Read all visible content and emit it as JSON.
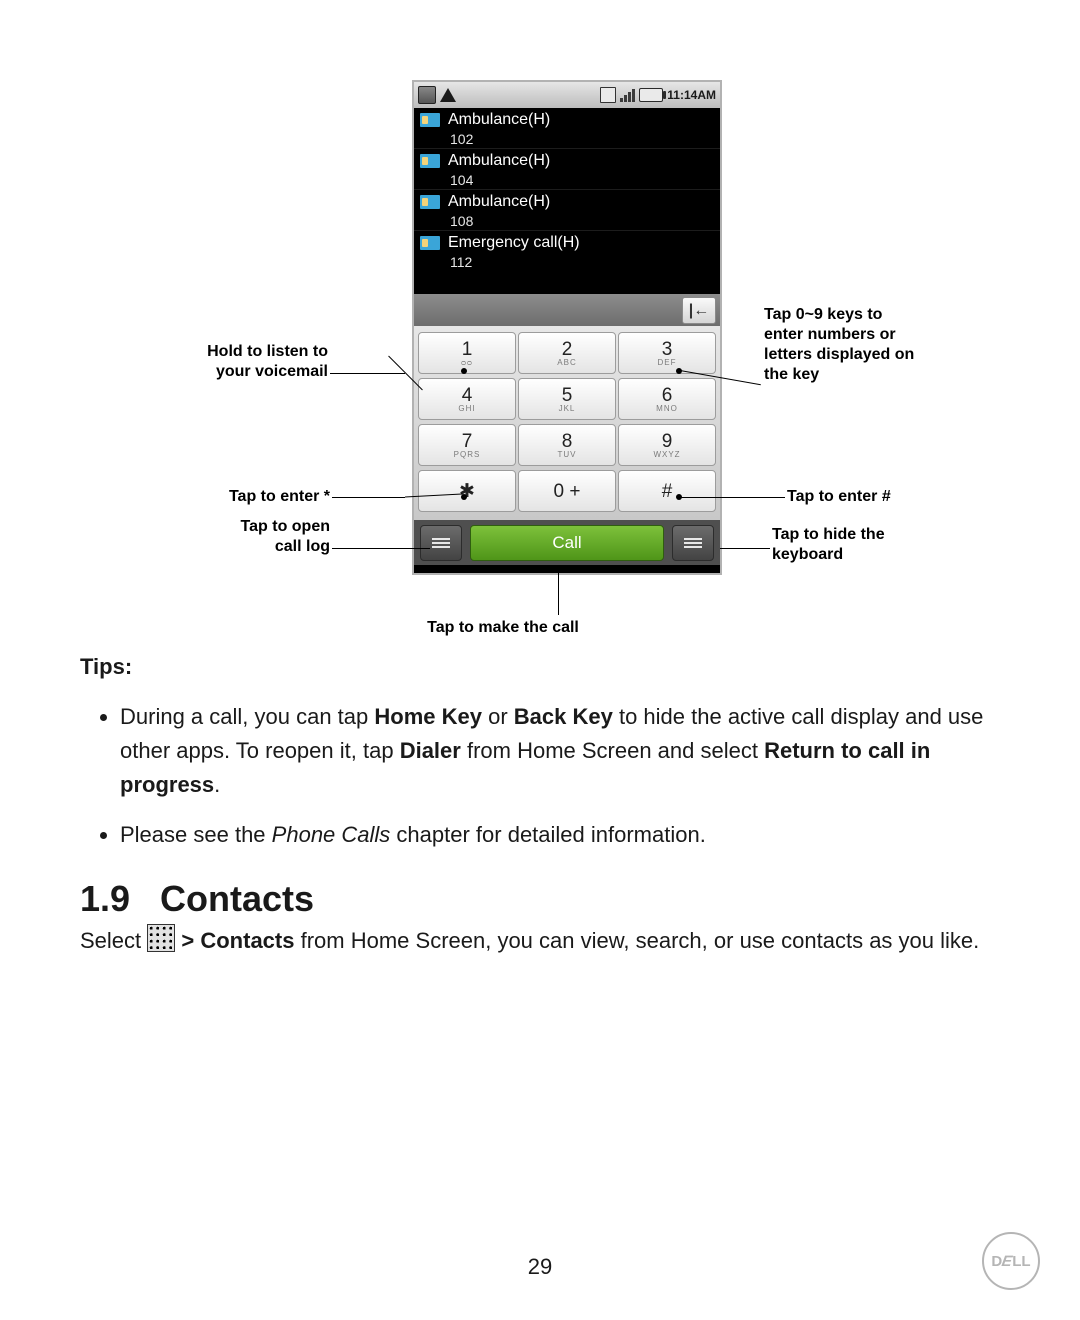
{
  "statusbar": {
    "time": "11:14AM"
  },
  "contacts": [
    {
      "name": "Ambulance(H)",
      "number": "102"
    },
    {
      "name": "Ambulance(H)",
      "number": "104"
    },
    {
      "name": "Ambulance(H)",
      "number": "108"
    },
    {
      "name": "Emergency call(H)",
      "number": "112"
    }
  ],
  "backspace_glyph": "|←",
  "keys": [
    [
      {
        "d": "1",
        "s": "ᴑᴑ"
      },
      {
        "d": "2",
        "s": "ABC"
      },
      {
        "d": "3",
        "s": "DEF"
      }
    ],
    [
      {
        "d": "4",
        "s": "GHI"
      },
      {
        "d": "5",
        "s": "JKL"
      },
      {
        "d": "6",
        "s": "MNO"
      }
    ],
    [
      {
        "d": "7",
        "s": "PQRS"
      },
      {
        "d": "8",
        "s": "TUV"
      },
      {
        "d": "9",
        "s": "WXYZ"
      }
    ],
    [
      {
        "d": "✱",
        "s": ""
      },
      {
        "d": "0 +",
        "s": ""
      },
      {
        "d": "#",
        "s": ""
      }
    ]
  ],
  "call_label": "Call",
  "callouts": {
    "voicemail": "Hold to listen to\nyour voicemail",
    "enterstar": "Tap to enter *",
    "calllog": "Tap to open\ncall log",
    "makecall": "Tap to make the call",
    "numkeys": "Tap 0~9 keys to\nenter numbers or\nletters displayed on\nthe key",
    "enterhash": "Tap to enter #",
    "hidekbd": "Tap to hide the\nkeyboard"
  },
  "tips_heading": "Tips:",
  "tips": {
    "t1a": "During a call, you can tap ",
    "t1b": "Home Key",
    "t1c": " or ",
    "t1d": "Back Key",
    "t1e": " to hide the active call display and use other apps. To reopen it, tap ",
    "t1f": "Dialer",
    "t1g": " from Home Screen and select ",
    "t1h": "Return to call in progress",
    "t1i": ".",
    "t2a": "Please see the ",
    "t2b": "Phone Calls",
    "t2c": " chapter for detailed information."
  },
  "section": {
    "num": "1.9",
    "title": "Contacts"
  },
  "section_body": {
    "a": "Select  ",
    "b": " > Contacts",
    "c": " from Home Screen, you can view, search, or use contacts as you like."
  },
  "page_number": "29",
  "brand": "DELL"
}
